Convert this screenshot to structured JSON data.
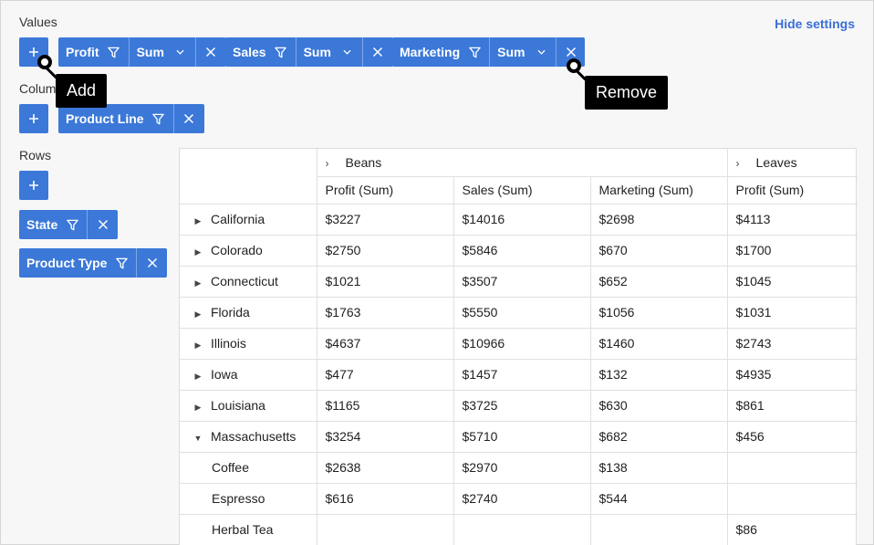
{
  "values_label": "Values",
  "columns_label": "Colum",
  "rows_label": "Rows",
  "hide_settings": "Hide settings",
  "tooltips": {
    "add": "Add",
    "remove": "Remove"
  },
  "value_chips": [
    {
      "name": "Profit",
      "agg": "Sum"
    },
    {
      "name": "Sales",
      "agg": "Sum"
    },
    {
      "name": "Marketing",
      "agg": "Sum"
    }
  ],
  "column_chips": [
    {
      "name": "Product Line"
    }
  ],
  "row_chips": [
    {
      "name": "State"
    },
    {
      "name": "Product Type"
    }
  ],
  "grid": {
    "col_groups": [
      "Beans",
      "Leaves"
    ],
    "headers": [
      "Profit (Sum)",
      "Sales (Sum)",
      "Marketing (Sum)",
      "Profit (Sum)"
    ],
    "rows": [
      {
        "label": "California",
        "toggle": "collapsed",
        "cells": [
          "$3227",
          "$14016",
          "$2698",
          "$4113"
        ]
      },
      {
        "label": "Colorado",
        "toggle": "collapsed",
        "cells": [
          "$2750",
          "$5846",
          "$670",
          "$1700"
        ]
      },
      {
        "label": "Connecticut",
        "toggle": "collapsed",
        "cells": [
          "$1021",
          "$3507",
          "$652",
          "$1045"
        ]
      },
      {
        "label": "Florida",
        "toggle": "collapsed",
        "cells": [
          "$1763",
          "$5550",
          "$1056",
          "$1031"
        ]
      },
      {
        "label": "Illinois",
        "toggle": "collapsed",
        "cells": [
          "$4637",
          "$10966",
          "$1460",
          "$2743"
        ]
      },
      {
        "label": "Iowa",
        "toggle": "collapsed",
        "cells": [
          "$477",
          "$1457",
          "$132",
          "$4935"
        ]
      },
      {
        "label": "Louisiana",
        "toggle": "collapsed",
        "cells": [
          "$1165",
          "$3725",
          "$630",
          "$861"
        ]
      },
      {
        "label": "Massachusetts",
        "toggle": "expanded",
        "cells": [
          "$3254",
          "$5710",
          "$682",
          "$456"
        ]
      },
      {
        "label": "Coffee",
        "toggle": "child",
        "cells": [
          "$2638",
          "$2970",
          "$138",
          ""
        ]
      },
      {
        "label": "Espresso",
        "toggle": "child",
        "cells": [
          "$616",
          "$2740",
          "$544",
          ""
        ]
      },
      {
        "label": "Herbal Tea",
        "toggle": "child",
        "cells": [
          "",
          "",
          "",
          "$86"
        ]
      }
    ]
  },
  "colors": {
    "accent": "#3b78d8",
    "link": "#3b6fd8"
  }
}
